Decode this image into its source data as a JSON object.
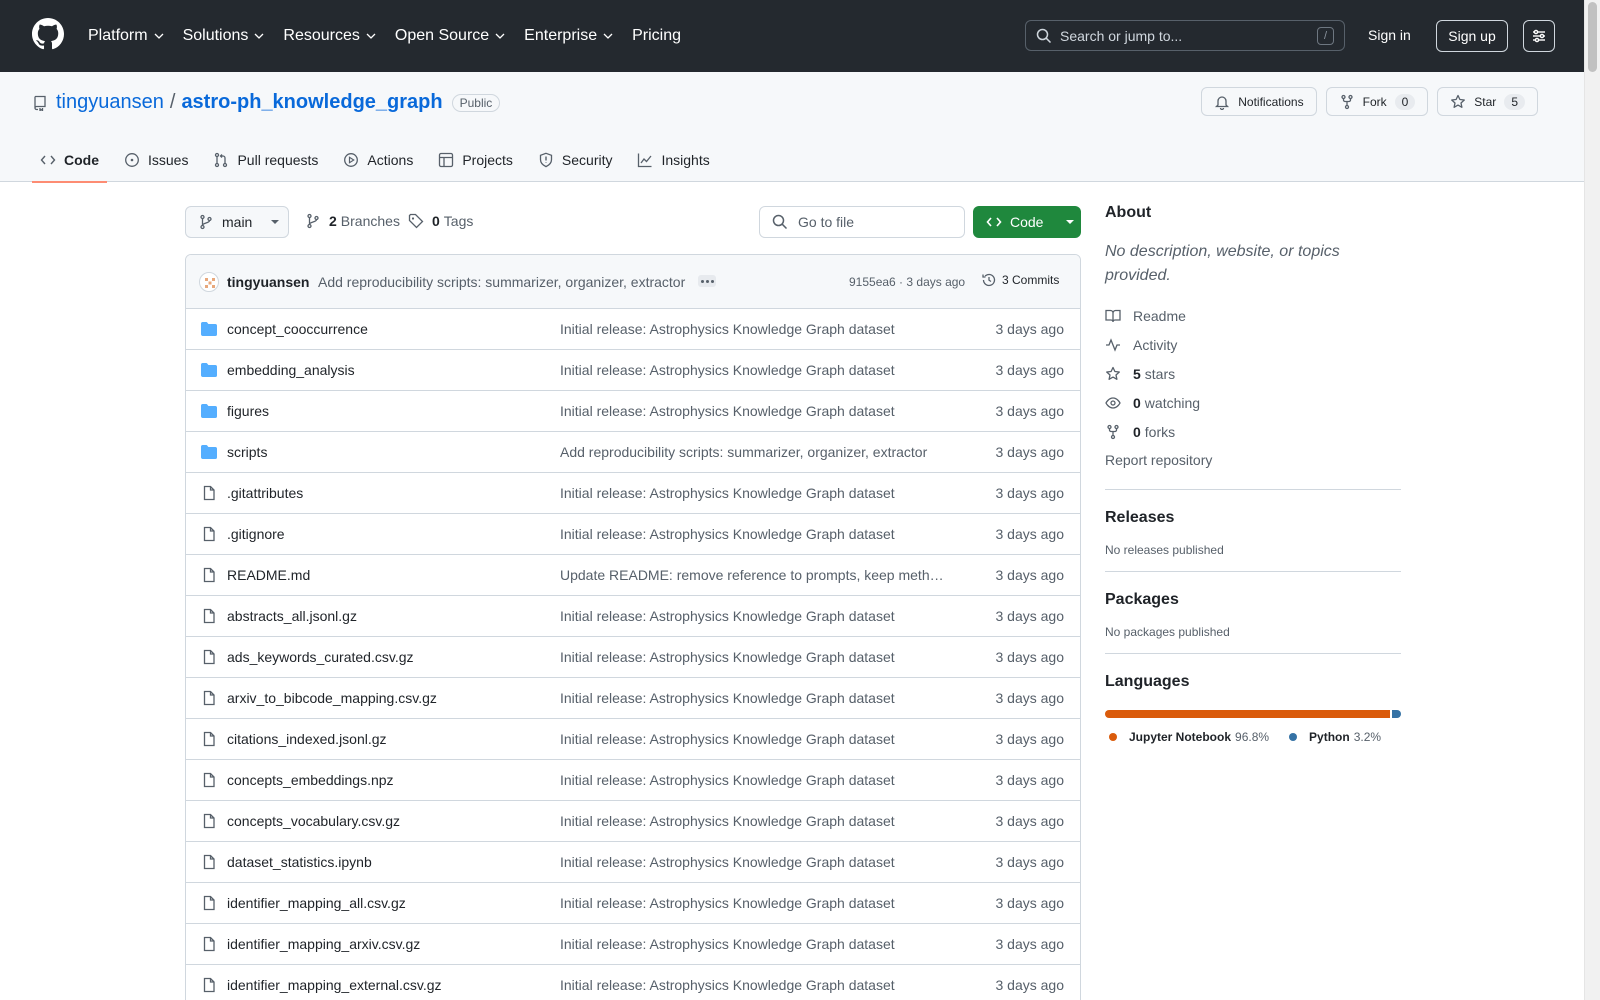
{
  "header": {
    "nav": [
      {
        "label": "Platform",
        "dropdown": true
      },
      {
        "label": "Solutions",
        "dropdown": true
      },
      {
        "label": "Resources",
        "dropdown": true
      },
      {
        "label": "Open Source",
        "dropdown": true
      },
      {
        "label": "Enterprise",
        "dropdown": true
      },
      {
        "label": "Pricing",
        "dropdown": false
      }
    ],
    "search_placeholder": "Search or jump to...",
    "search_shortcut": "/",
    "sign_in": "Sign in",
    "sign_up": "Sign up"
  },
  "repo": {
    "owner": "tingyuansen",
    "separator": "/",
    "name": "astro-ph_knowledge_graph",
    "visibility": "Public",
    "notifications_label": "Notifications",
    "fork_label": "Fork",
    "fork_count": "0",
    "star_label": "Star",
    "star_count": "5"
  },
  "repo_nav": [
    {
      "label": "Code",
      "icon": "code-icon",
      "active": true
    },
    {
      "label": "Issues",
      "icon": "issue-icon",
      "active": false
    },
    {
      "label": "Pull requests",
      "icon": "pull-request-icon",
      "active": false
    },
    {
      "label": "Actions",
      "icon": "play-icon",
      "active": false
    },
    {
      "label": "Projects",
      "icon": "table-icon",
      "active": false
    },
    {
      "label": "Security",
      "icon": "shield-icon",
      "active": false
    },
    {
      "label": "Insights",
      "icon": "graph-icon",
      "active": false
    }
  ],
  "toolbar": {
    "branch": "main",
    "branches_count": "2",
    "branches_label": "Branches",
    "tags_count": "0",
    "tags_label": "Tags",
    "goto_placeholder": "Go to file",
    "code_button": "Code"
  },
  "latest_commit": {
    "author": "tingyuansen",
    "message": "Add reproducibility scripts: summarizer, organizer, extractor",
    "hash_time": "9155ea6 · 3 days ago",
    "commits_label": "3 Commits"
  },
  "files": [
    {
      "name": "concept_cooccurrence",
      "type": "dir",
      "message": "Initial release: Astrophysics Knowledge Graph dataset",
      "date": "3 days ago"
    },
    {
      "name": "embedding_analysis",
      "type": "dir",
      "message": "Initial release: Astrophysics Knowledge Graph dataset",
      "date": "3 days ago"
    },
    {
      "name": "figures",
      "type": "dir",
      "message": "Initial release: Astrophysics Knowledge Graph dataset",
      "date": "3 days ago"
    },
    {
      "name": "scripts",
      "type": "dir",
      "message": "Add reproducibility scripts: summarizer, organizer, extractor",
      "date": "3 days ago"
    },
    {
      "name": ".gitattributes",
      "type": "file",
      "message": "Initial release: Astrophysics Knowledge Graph dataset",
      "date": "3 days ago"
    },
    {
      "name": ".gitignore",
      "type": "file",
      "message": "Initial release: Astrophysics Knowledge Graph dataset",
      "date": "3 days ago"
    },
    {
      "name": "README.md",
      "type": "file",
      "message": "Update README: remove reference to prompts, keep meth…",
      "date": "3 days ago"
    },
    {
      "name": "abstracts_all.jsonl.gz",
      "type": "file",
      "message": "Initial release: Astrophysics Knowledge Graph dataset",
      "date": "3 days ago"
    },
    {
      "name": "ads_keywords_curated.csv.gz",
      "type": "file",
      "message": "Initial release: Astrophysics Knowledge Graph dataset",
      "date": "3 days ago"
    },
    {
      "name": "arxiv_to_bibcode_mapping.csv.gz",
      "type": "file",
      "message": "Initial release: Astrophysics Knowledge Graph dataset",
      "date": "3 days ago"
    },
    {
      "name": "citations_indexed.jsonl.gz",
      "type": "file",
      "message": "Initial release: Astrophysics Knowledge Graph dataset",
      "date": "3 days ago"
    },
    {
      "name": "concepts_embeddings.npz",
      "type": "file",
      "message": "Initial release: Astrophysics Knowledge Graph dataset",
      "date": "3 days ago"
    },
    {
      "name": "concepts_vocabulary.csv.gz",
      "type": "file",
      "message": "Initial release: Astrophysics Knowledge Graph dataset",
      "date": "3 days ago"
    },
    {
      "name": "dataset_statistics.ipynb",
      "type": "file",
      "message": "Initial release: Astrophysics Knowledge Graph dataset",
      "date": "3 days ago"
    },
    {
      "name": "identifier_mapping_all.csv.gz",
      "type": "file",
      "message": "Initial release: Astrophysics Knowledge Graph dataset",
      "date": "3 days ago"
    },
    {
      "name": "identifier_mapping_arxiv.csv.gz",
      "type": "file",
      "message": "Initial release: Astrophysics Knowledge Graph dataset",
      "date": "3 days ago"
    },
    {
      "name": "identifier_mapping_external.csv.gz",
      "type": "file",
      "message": "Initial release: Astrophysics Knowledge Graph dataset",
      "date": "3 days ago"
    }
  ],
  "sidebar": {
    "about_title": "About",
    "about_desc": "No description, website, or topics provided.",
    "readme": "Readme",
    "activity": "Activity",
    "stars_count": "5",
    "stars_label": "stars",
    "watching_count": "0",
    "watching_label": "watching",
    "forks_count": "0",
    "forks_label": "forks",
    "report": "Report repository",
    "releases_title": "Releases",
    "releases_sub": "No releases published",
    "packages_title": "Packages",
    "packages_sub": "No packages published",
    "languages_title": "Languages",
    "languages": [
      {
        "name": "Jupyter Notebook",
        "percent": "96.8%",
        "value": 96.8,
        "color": "#DA5B0B"
      },
      {
        "name": "Python",
        "percent": "3.2%",
        "value": 3.2,
        "color": "#3572A5"
      }
    ]
  }
}
